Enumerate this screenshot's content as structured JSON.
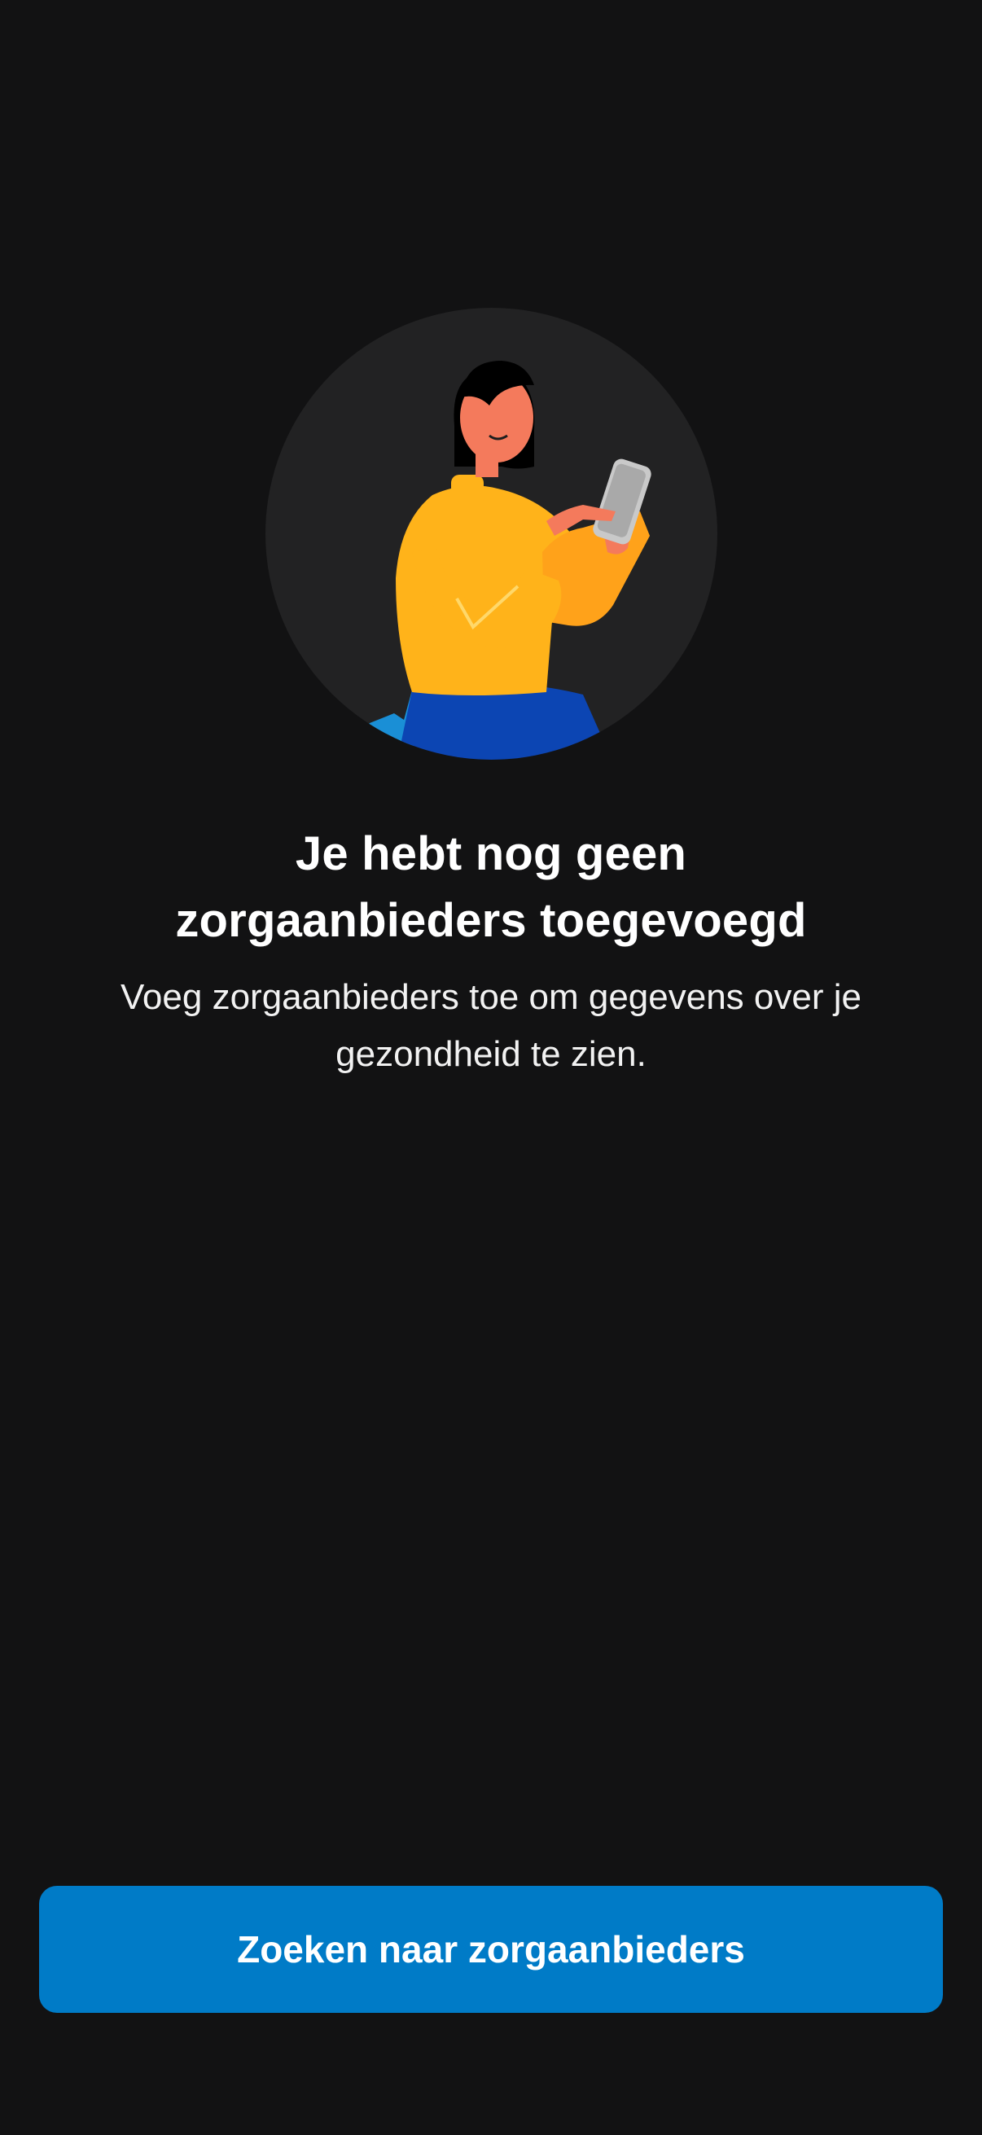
{
  "empty_state": {
    "illustration_icon": "person-with-phone-illustration",
    "title_line1": "Je hebt nog geen",
    "title_line2": "zorgaanbieders toegevoegd",
    "description": "Voeg zorgaanbieders toe om gegevens over je gezondheid te zien."
  },
  "actions": {
    "search_button_label": "Zoeken naar zorgaanbieders"
  },
  "colors": {
    "background": "#121213",
    "illustration_circle": "#222223",
    "primary_button": "#007BC7",
    "text": "#FFFFFF"
  }
}
